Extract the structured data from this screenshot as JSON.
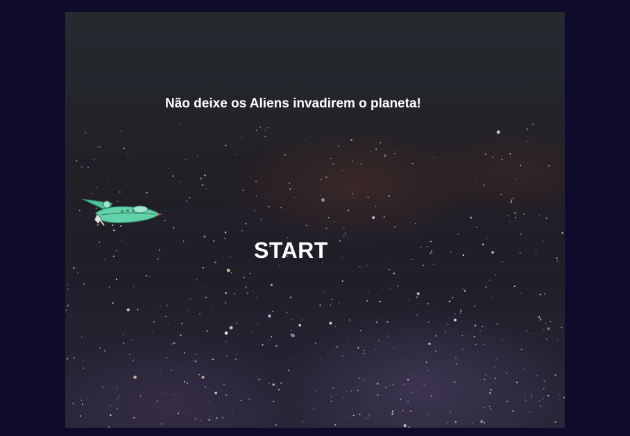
{
  "game": {
    "subtitle": "Não deixe os Aliens invadirem o planeta!",
    "start_label": "START",
    "player_ship_icon": "planet-express-ship-icon",
    "colors": {
      "page_background": "#0e0b2b",
      "text": "#ffffff",
      "ship_body": "#5fd1a6"
    }
  }
}
